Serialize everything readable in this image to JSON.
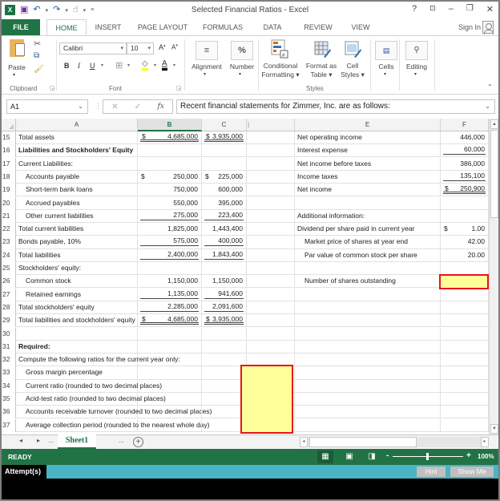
{
  "app": {
    "title": "Selected Financial Ratios - Excel",
    "window_controls": {
      "help": "?",
      "restore_ribbon": "⊡",
      "minimize": "–",
      "restore": "🗗",
      "close": "✕"
    },
    "sign_in": "Sign In"
  },
  "ribbon_tabs": [
    "FILE",
    "HOME",
    "INSERT",
    "PAGE LAYOUT",
    "FORMULAS",
    "DATA",
    "REVIEW",
    "VIEW"
  ],
  "active_tab": "HOME",
  "ribbon": {
    "clipboard": {
      "paste": "Paste",
      "label": "Clipboard"
    },
    "font": {
      "font_name": "Calibri",
      "font_size": "10",
      "bold": "B",
      "italic": "I",
      "underline": "U",
      "label": "Font"
    },
    "alignment": {
      "label": "Alignment"
    },
    "number": {
      "label": "Number",
      "icon_text": "%"
    },
    "styles": {
      "conditional_formatting": [
        "Conditional",
        "Formatting ▾"
      ],
      "format_as_table": [
        "Format as",
        "Table ▾"
      ],
      "cell_styles": [
        "Cell",
        "Styles ▾"
      ],
      "label": "Styles"
    },
    "cells": {
      "label": "Cells"
    },
    "editing": {
      "label": "Editing"
    }
  },
  "formula_bar": {
    "name_box": "A1",
    "cancel": "✕",
    "enter": "✓",
    "fx": "fx",
    "content": "Recent financial statements for Zimmer, Inc. are as follows:"
  },
  "columns": [
    "A",
    "B",
    "C",
    "",
    "E",
    "F"
  ],
  "selected_column": "B",
  "rows": [
    {
      "n": "15",
      "a": "Total assets",
      "b_cur": "$",
      "b": "4,685,000",
      "c_cur": "$",
      "c": "3,935,000",
      "e": "Net operating income",
      "f": "446,000"
    },
    {
      "n": "16",
      "a": "Liabilities and Stockholders' Equity",
      "e": "Interest expense",
      "f": "60,000"
    },
    {
      "n": "17",
      "a": "Current Liabilities:",
      "e": "Net income before taxes",
      "f": "386,000"
    },
    {
      "n": "18",
      "a": "Accounts payable",
      "b_cur": "$",
      "b": "250,000",
      "c_cur": "$",
      "c": "225,000",
      "e": "Income taxes",
      "f": "135,100"
    },
    {
      "n": "19",
      "a": "Short-term bank loans",
      "b": "750,000",
      "c": "600,000",
      "e": "Net income",
      "f_cur": "$",
      "f": "250,900"
    },
    {
      "n": "20",
      "a": "Accrued payables",
      "b": "550,000",
      "c": "395,000"
    },
    {
      "n": "21",
      "a": "Other current liabilities",
      "b": "275,000",
      "c": "223,400",
      "e": "Additional information:"
    },
    {
      "n": "22",
      "a": "Total current liabilities",
      "b": "1,825,000",
      "c": "1,443,400",
      "e": "Dividend per share paid in current year",
      "f_cur": "$",
      "f": "1.00"
    },
    {
      "n": "23",
      "a": "Bonds payable, 10%",
      "b": "575,000",
      "c": "400,000",
      "e": "Market price of shares at year end",
      "f": "42.00"
    },
    {
      "n": "24",
      "a": "Total liabilities",
      "b": "2,400,000",
      "c": "1,843,400",
      "e": "Par value of common stock per share",
      "f": "20.00"
    },
    {
      "n": "25",
      "a": "Stockholders' equity:"
    },
    {
      "n": "26",
      "a": "Common stock",
      "b": "1,150,000",
      "c": "1,150,000",
      "e": "Number of shares outstanding",
      "f": ""
    },
    {
      "n": "27",
      "a": "Retained earnings",
      "b": "1,135,000",
      "c": "941,600"
    },
    {
      "n": "28",
      "a": "Total stockholders' equity",
      "b": "2,285,000",
      "c": "2,091,600"
    },
    {
      "n": "29",
      "a": "Total liabilities and stockholders' equity",
      "b_cur": "$",
      "b": "4,685,000",
      "c_cur": "$",
      "c": "3,935,000"
    },
    {
      "n": "30",
      "a": ""
    },
    {
      "n": "31",
      "a": "Required:"
    },
    {
      "n": "32",
      "a": "Compute the following ratios for the current year only:"
    },
    {
      "n": "33",
      "a": "Gross margin percentage"
    },
    {
      "n": "34",
      "a": "Current ratio (rounded to two decimal places)"
    },
    {
      "n": "35",
      "a": "Acid-test ratio (rounded to two decimal places)"
    },
    {
      "n": "36",
      "a": "Accounts receivable turnover (rounded to two decimal places)"
    },
    {
      "n": "37",
      "a": "Average collection period (rounded to the nearest whole day)"
    }
  ],
  "answer_cells": {
    "shares_outstanding": "",
    "ratios": [
      "",
      "",
      "",
      "",
      ""
    ]
  },
  "sheet_tabs": {
    "active": "Sheet1",
    "ellipsis": "...",
    "add": "+"
  },
  "status_bar": {
    "status": "READY",
    "zoom": "100%",
    "zoom_minus": "-",
    "zoom_plus": "+"
  },
  "attempt_bar": {
    "label": "Attempt(s)",
    "hint": "Hint",
    "show_me": "Show Me"
  },
  "colors": {
    "excel_green": "#217346",
    "answer_fill": "#ffff99",
    "answer_border": "#e8141b",
    "attempt_bar": "#4ab3c4"
  }
}
